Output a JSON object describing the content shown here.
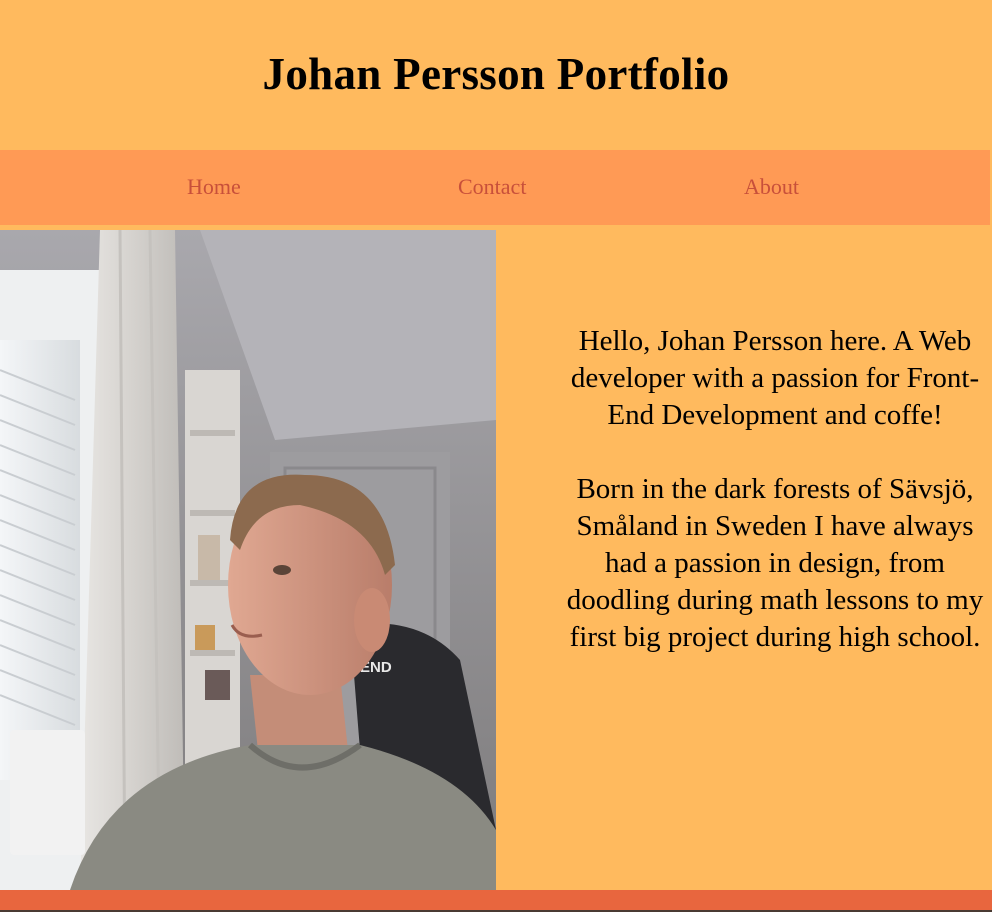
{
  "header": {
    "title": "Johan Persson Portfolio"
  },
  "nav": {
    "items": [
      {
        "label": "Home"
      },
      {
        "label": "Contact"
      },
      {
        "label": "About"
      }
    ]
  },
  "main": {
    "photo": {
      "chair_brand": "END"
    },
    "bio": {
      "paragraphs": [
        "Hello, Johan Persson here. A Web developer with a passion for Front-End Development and coffe!",
        "Born in the dark forests of Sävsjö, Småland in Sweden I have always had a passion in design, from doodling during math lessons to my first big project during high school."
      ]
    }
  },
  "colors": {
    "background": "#FFBA5E",
    "nav_background": "#FF9A55",
    "nav_link": "#C8503A",
    "footer": "#E8663E"
  }
}
